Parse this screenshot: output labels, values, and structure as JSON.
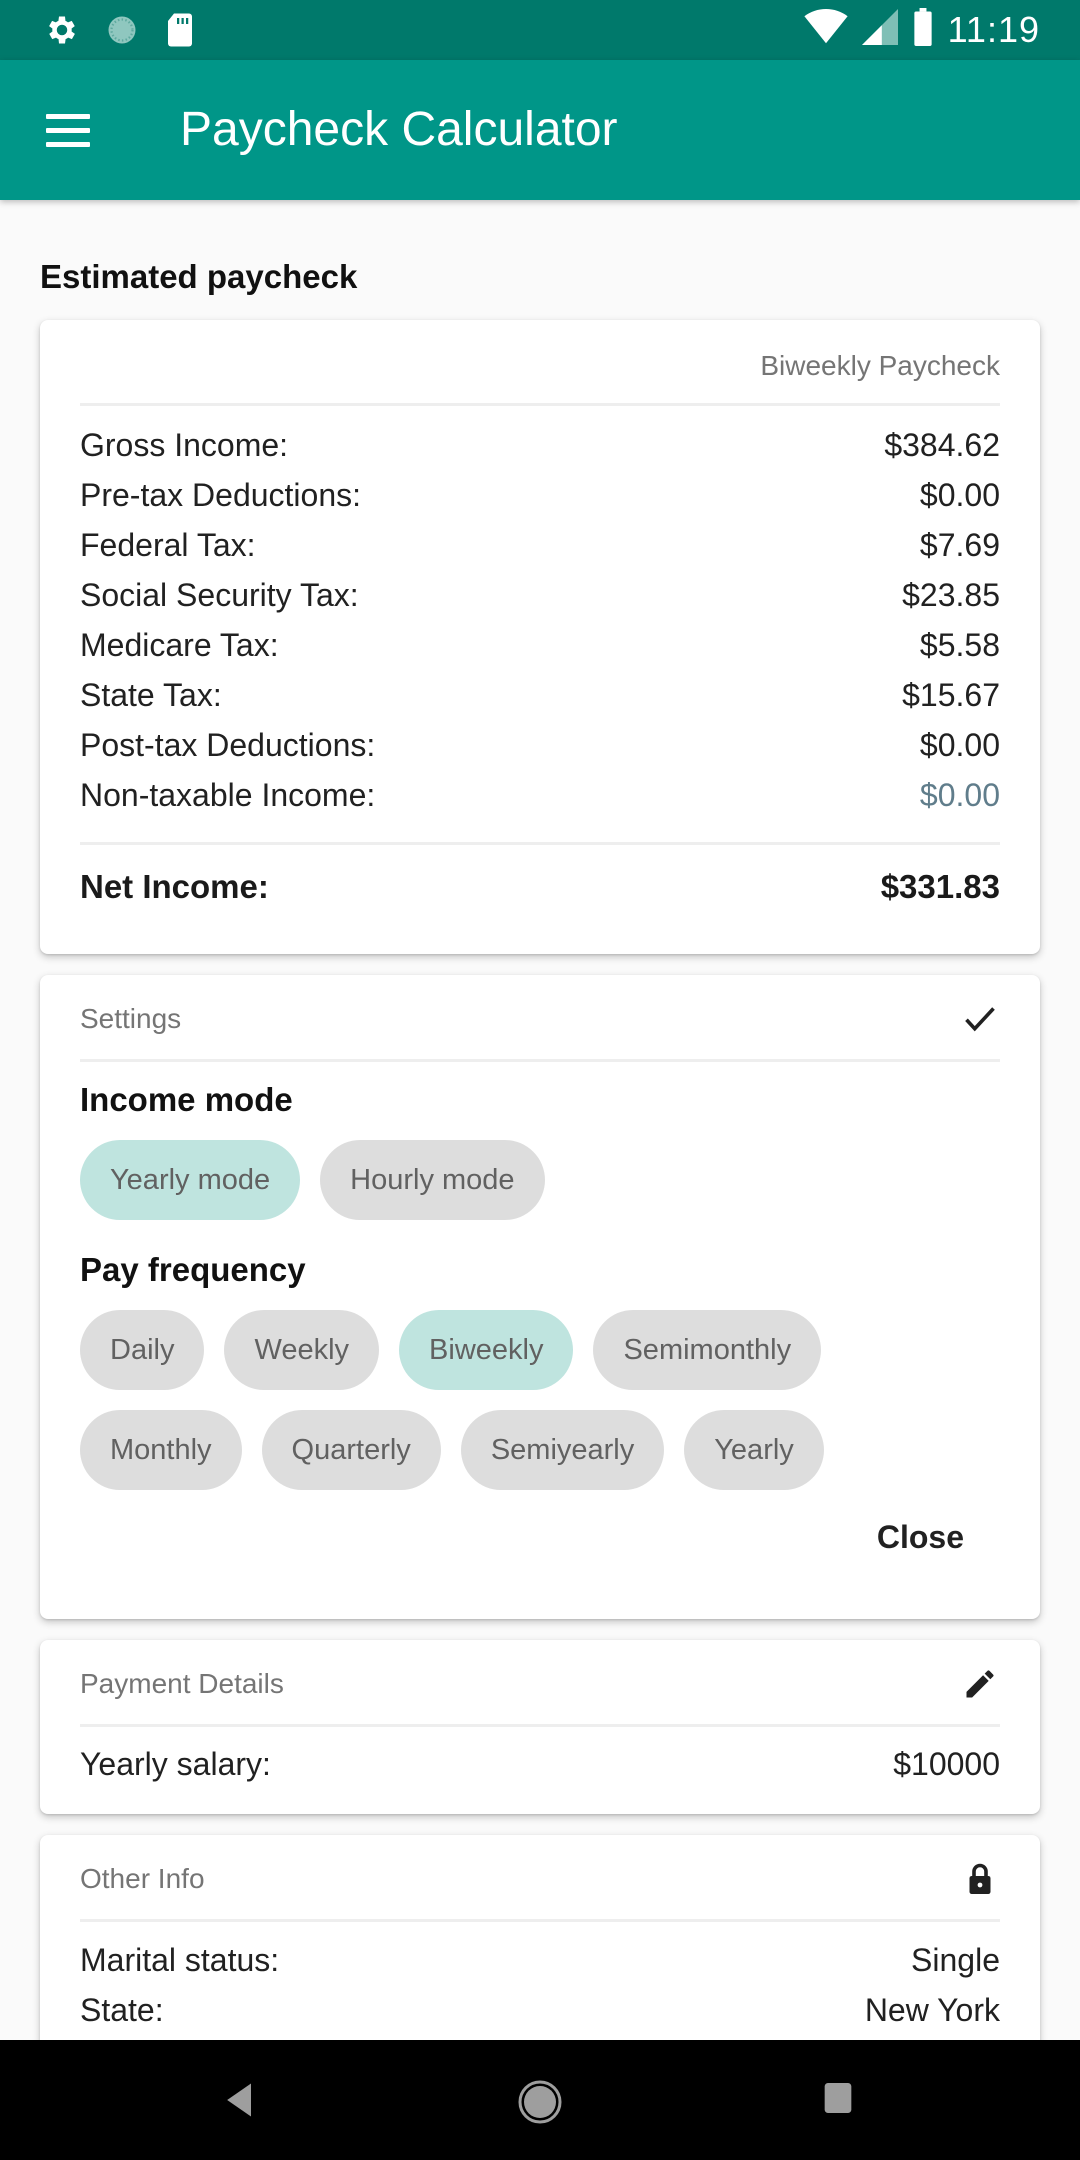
{
  "status_bar": {
    "time": "11:19",
    "left_icons": [
      "settings-icon",
      "sync-icon",
      "sd-card-icon"
    ],
    "right_icons": [
      "wifi-icon",
      "cell-signal-icon",
      "battery-icon"
    ]
  },
  "app_bar": {
    "title": "Paycheck Calculator",
    "menu_icon": "hamburger-menu-icon"
  },
  "estimated": {
    "section_title": "Estimated paycheck",
    "caption": "Biweekly Paycheck",
    "rows": [
      {
        "label": "Gross Income:",
        "value": "$384.62"
      },
      {
        "label": "Pre-tax Deductions:",
        "value": "$0.00"
      },
      {
        "label": "Federal Tax:",
        "value": "$7.69"
      },
      {
        "label": "Social Security Tax:",
        "value": "$23.85"
      },
      {
        "label": "Medicare Tax:",
        "value": "$5.58"
      },
      {
        "label": "State Tax:",
        "value": "$15.67"
      },
      {
        "label": "Post-tax Deductions:",
        "value": "$0.00"
      },
      {
        "label": "Non-taxable Income:",
        "value": "$0.00"
      }
    ],
    "net": {
      "label": "Net Income:",
      "value": "$331.83"
    }
  },
  "settings": {
    "header": "Settings",
    "header_icon": "check-icon",
    "income_mode": {
      "heading": "Income mode",
      "options": [
        "Yearly mode",
        "Hourly mode"
      ],
      "selected": "Yearly mode"
    },
    "pay_frequency": {
      "heading": "Pay frequency",
      "options": [
        "Daily",
        "Weekly",
        "Biweekly",
        "Semimonthly",
        "Monthly",
        "Quarterly",
        "Semiyearly",
        "Yearly"
      ],
      "selected": "Biweekly"
    },
    "close_label": "Close"
  },
  "payment_details": {
    "header": "Payment Details",
    "header_icon": "edit-pencil-icon",
    "rows": [
      {
        "label": "Yearly salary:",
        "value": "$10000"
      }
    ]
  },
  "other_info": {
    "header": "Other Info",
    "header_icon": "lock-icon",
    "rows": [
      {
        "label": "Marital status:",
        "value": "Single"
      },
      {
        "label": "State:",
        "value": "New York"
      }
    ]
  },
  "colors": {
    "status_bar": "#00796b",
    "app_bar": "#009688",
    "chip_selected": "#bfe4df",
    "chip_default": "#dddddd",
    "muted_value": "#607d8b"
  }
}
